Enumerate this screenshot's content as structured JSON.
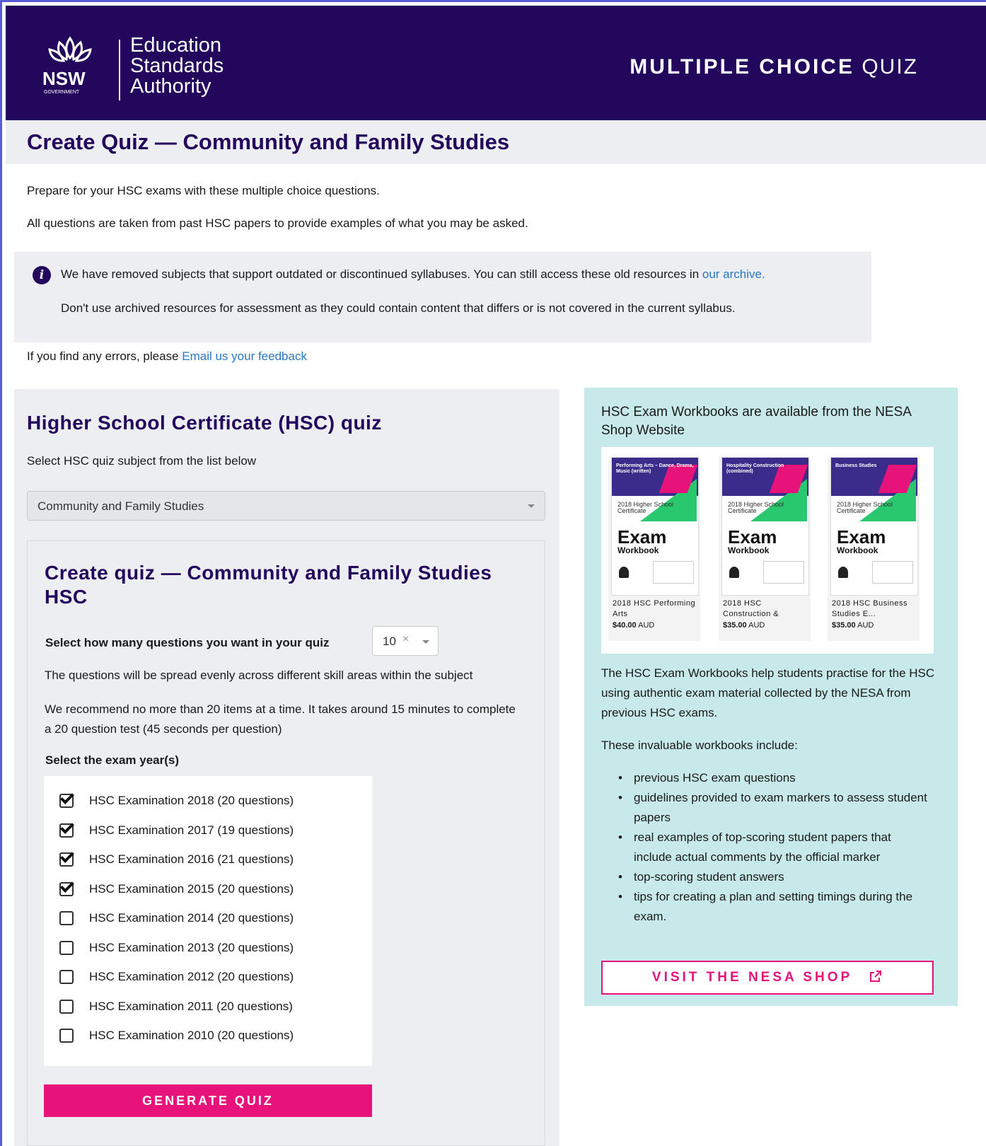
{
  "header": {
    "logo_lines": [
      "Education",
      "Standards",
      "Authority"
    ],
    "logo_gov": "NSW",
    "logo_gov_sub": "GOVERNMENT",
    "title_bold": "MULTIPLE CHOICE",
    "title_light": "QUIZ"
  },
  "page": {
    "title": "Create Quiz — Community and Family Studies",
    "intro1": "Prepare for your HSC exams with these multiple choice questions.",
    "intro2": "All questions are taken from past HSC papers to provide examples of what you may be asked.",
    "notice1_text": "We have removed subjects that support outdated or discontinued syllabuses. You can still access these old resources in",
    "notice1_link": "our archive.",
    "notice2": "Don't use archived resources for assessment as they could contain content that differs or is not covered in the current syllabus.",
    "feedback_text": "If you find any errors, please",
    "feedback_link": "Email us your feedback"
  },
  "quiz_panel": {
    "heading": "Higher School Certificate (HSC) quiz",
    "select_label": "Select HSC quiz subject from the list below",
    "subject_value": "Community and Family Studies",
    "create_heading": "Create quiz — Community and Family Studies HSC",
    "num_label": "Select how many questions you want in your quiz",
    "num_value": "10",
    "num_clear": "×",
    "spread_text": "The questions will be spread evenly across different skill areas within the subject",
    "recommend_text": "We recommend no more than 20 items at a time. It takes around 15 minutes to complete a 20 question test (45 seconds per question)",
    "year_label": "Select the exam year(s)",
    "years": [
      {
        "label": "HSC Examination 2018 (20 questions)",
        "checked": true
      },
      {
        "label": "HSC Examination 2017 (19 questions)",
        "checked": true
      },
      {
        "label": "HSC Examination 2016 (21 questions)",
        "checked": true
      },
      {
        "label": "HSC Examination 2015 (20 questions)",
        "checked": true
      },
      {
        "label": "HSC Examination 2014 (20 questions)",
        "checked": false
      },
      {
        "label": "HSC Examination 2013 (20 questions)",
        "checked": false
      },
      {
        "label": "HSC Examination 2012 (20 questions)",
        "checked": false
      },
      {
        "label": "HSC Examination 2011 (20 questions)",
        "checked": false
      },
      {
        "label": "HSC Examination 2010 (20 questions)",
        "checked": false
      }
    ],
    "generate_label": "GENERATE QUIZ"
  },
  "shop_panel": {
    "heading": "HSC Exam Workbooks are available from the NESA Shop Website",
    "books": [
      {
        "cover_title": "Performing Arts – Dance, Drama, Music (written)",
        "cover_year": "2018 Higher School Certificate",
        "exam": "Exam",
        "workbook": "Workbook",
        "name": "2018 HSC Performing Arts",
        "price": "$40.00",
        "currency": "AUD"
      },
      {
        "cover_title": "Hospitality Construction (combined)",
        "cover_year": "2018 Higher School Certificate",
        "exam": "Exam",
        "workbook": "Workbook",
        "name": "2018 HSC Construction &",
        "price": "$35.00",
        "currency": "AUD"
      },
      {
        "cover_title": "Business Studies",
        "cover_year": "2018 Higher School Certificate",
        "exam": "Exam",
        "workbook": "Workbook",
        "name": "2018 HSC Business Studies E...",
        "price": "$35.00",
        "currency": "AUD"
      }
    ],
    "description": "The HSC Exam Workbooks help students practise for the HSC using authentic exam material collected by the NESA from previous HSC exams.",
    "includes_label": "These invaluable workbooks include:",
    "includes": [
      "previous HSC exam questions",
      "guidelines provided to exam markers to assess student papers",
      "real examples of top-scoring student papers that include actual comments by the official marker",
      "top-scoring student answers",
      "tips for creating a plan and setting timings during the exam."
    ],
    "shop_button": "VISIT THE NESA SHOP",
    "shop_icon": "external-link-icon"
  },
  "colors": {
    "header_bg": "#23075c",
    "accent_pink": "#e8137a",
    "panel_grey": "#eceef2",
    "panel_teal": "#c7e9e9",
    "link_blue": "#2777c8"
  }
}
